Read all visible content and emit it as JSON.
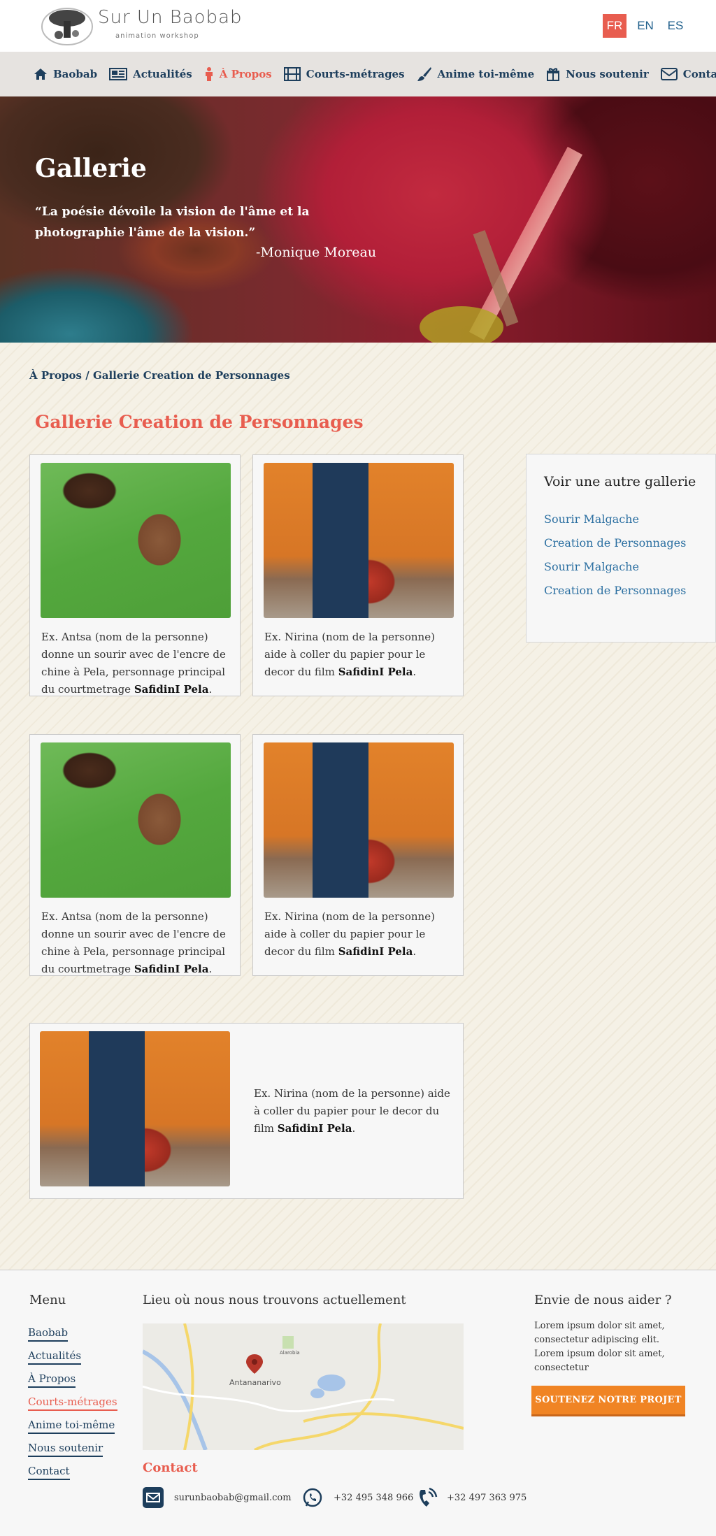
{
  "header": {
    "logo_text": "Sur Un Baobab",
    "logo_subtitle": "animation workshop",
    "languages": [
      {
        "label": "FR",
        "active": true
      },
      {
        "label": "EN",
        "active": false
      },
      {
        "label": "ES",
        "active": false
      }
    ]
  },
  "nav": {
    "items": [
      {
        "label": "Baobab",
        "icon": "home-icon"
      },
      {
        "label": "Actualités",
        "icon": "newspaper-icon"
      },
      {
        "label": "À Propos",
        "icon": "person-icon",
        "active": true
      },
      {
        "label": "Courts-métrages",
        "icon": "film-icon"
      },
      {
        "label": "Anime toi-même",
        "icon": "brush-icon"
      },
      {
        "label": "Nous soutenir",
        "icon": "gift-icon"
      },
      {
        "label": "Contact",
        "icon": "envelope-icon"
      }
    ]
  },
  "hero": {
    "title": "Gallerie",
    "quote": "“La poésie dévoile la vision de l'âme et la photographie l'âme de la vision.”",
    "author": "-Monique Moreau"
  },
  "breadcrumb": {
    "parent": "À Propos",
    "separator": " / ",
    "current": "Gallerie Creation de Personnages"
  },
  "page_title": "Gallerie Creation de Personnages",
  "gallery": {
    "captions": {
      "antsa_prefix": "Ex. Antsa (nom de la personne) donne un sourir avec de l'encre de chine à Pela, personnage principal du courtmetrage ",
      "nirina_prefix": "Ex. Nirina (nom de la personne) aide à coller du papier pour le decor du film ",
      "film": "SafidinI Pela",
      "suffix": "."
    }
  },
  "sidebar": {
    "title": "Voir une autre gallerie",
    "links": [
      "Sourir Malgache",
      "Creation de Personnages",
      "Sourir Malgache",
      "Creation de Personnages"
    ]
  },
  "footer": {
    "menu_title": "Menu",
    "menu_items": [
      "Baobab",
      "Actualités",
      "À Propos",
      "Courts-métrages",
      "Anime toi-même",
      "Nous soutenir",
      "Contact"
    ],
    "location_title": "Lieu où nous nous trouvons actuellement",
    "map_labels": {
      "city": "Antananarivo",
      "poi": "Alarobia"
    },
    "contact_title": "Contact",
    "email": "surunbaobab@gmail.com",
    "phone1": "+32 495 348 966",
    "phone2": "+32 497 363 975",
    "help_title": "Envie de nous aider ?",
    "help_text": "Lorem ipsum dolor sit amet, consectetur adipiscing elit. Lorem ipsum dolor sit amet, consectetur",
    "support_button": "SOUTENEZ NOTRE PROJET"
  },
  "colors": {
    "accent": "#e85d4f",
    "navy": "#1d3e5c",
    "link": "#2b6fa1",
    "button": "#f08424"
  }
}
